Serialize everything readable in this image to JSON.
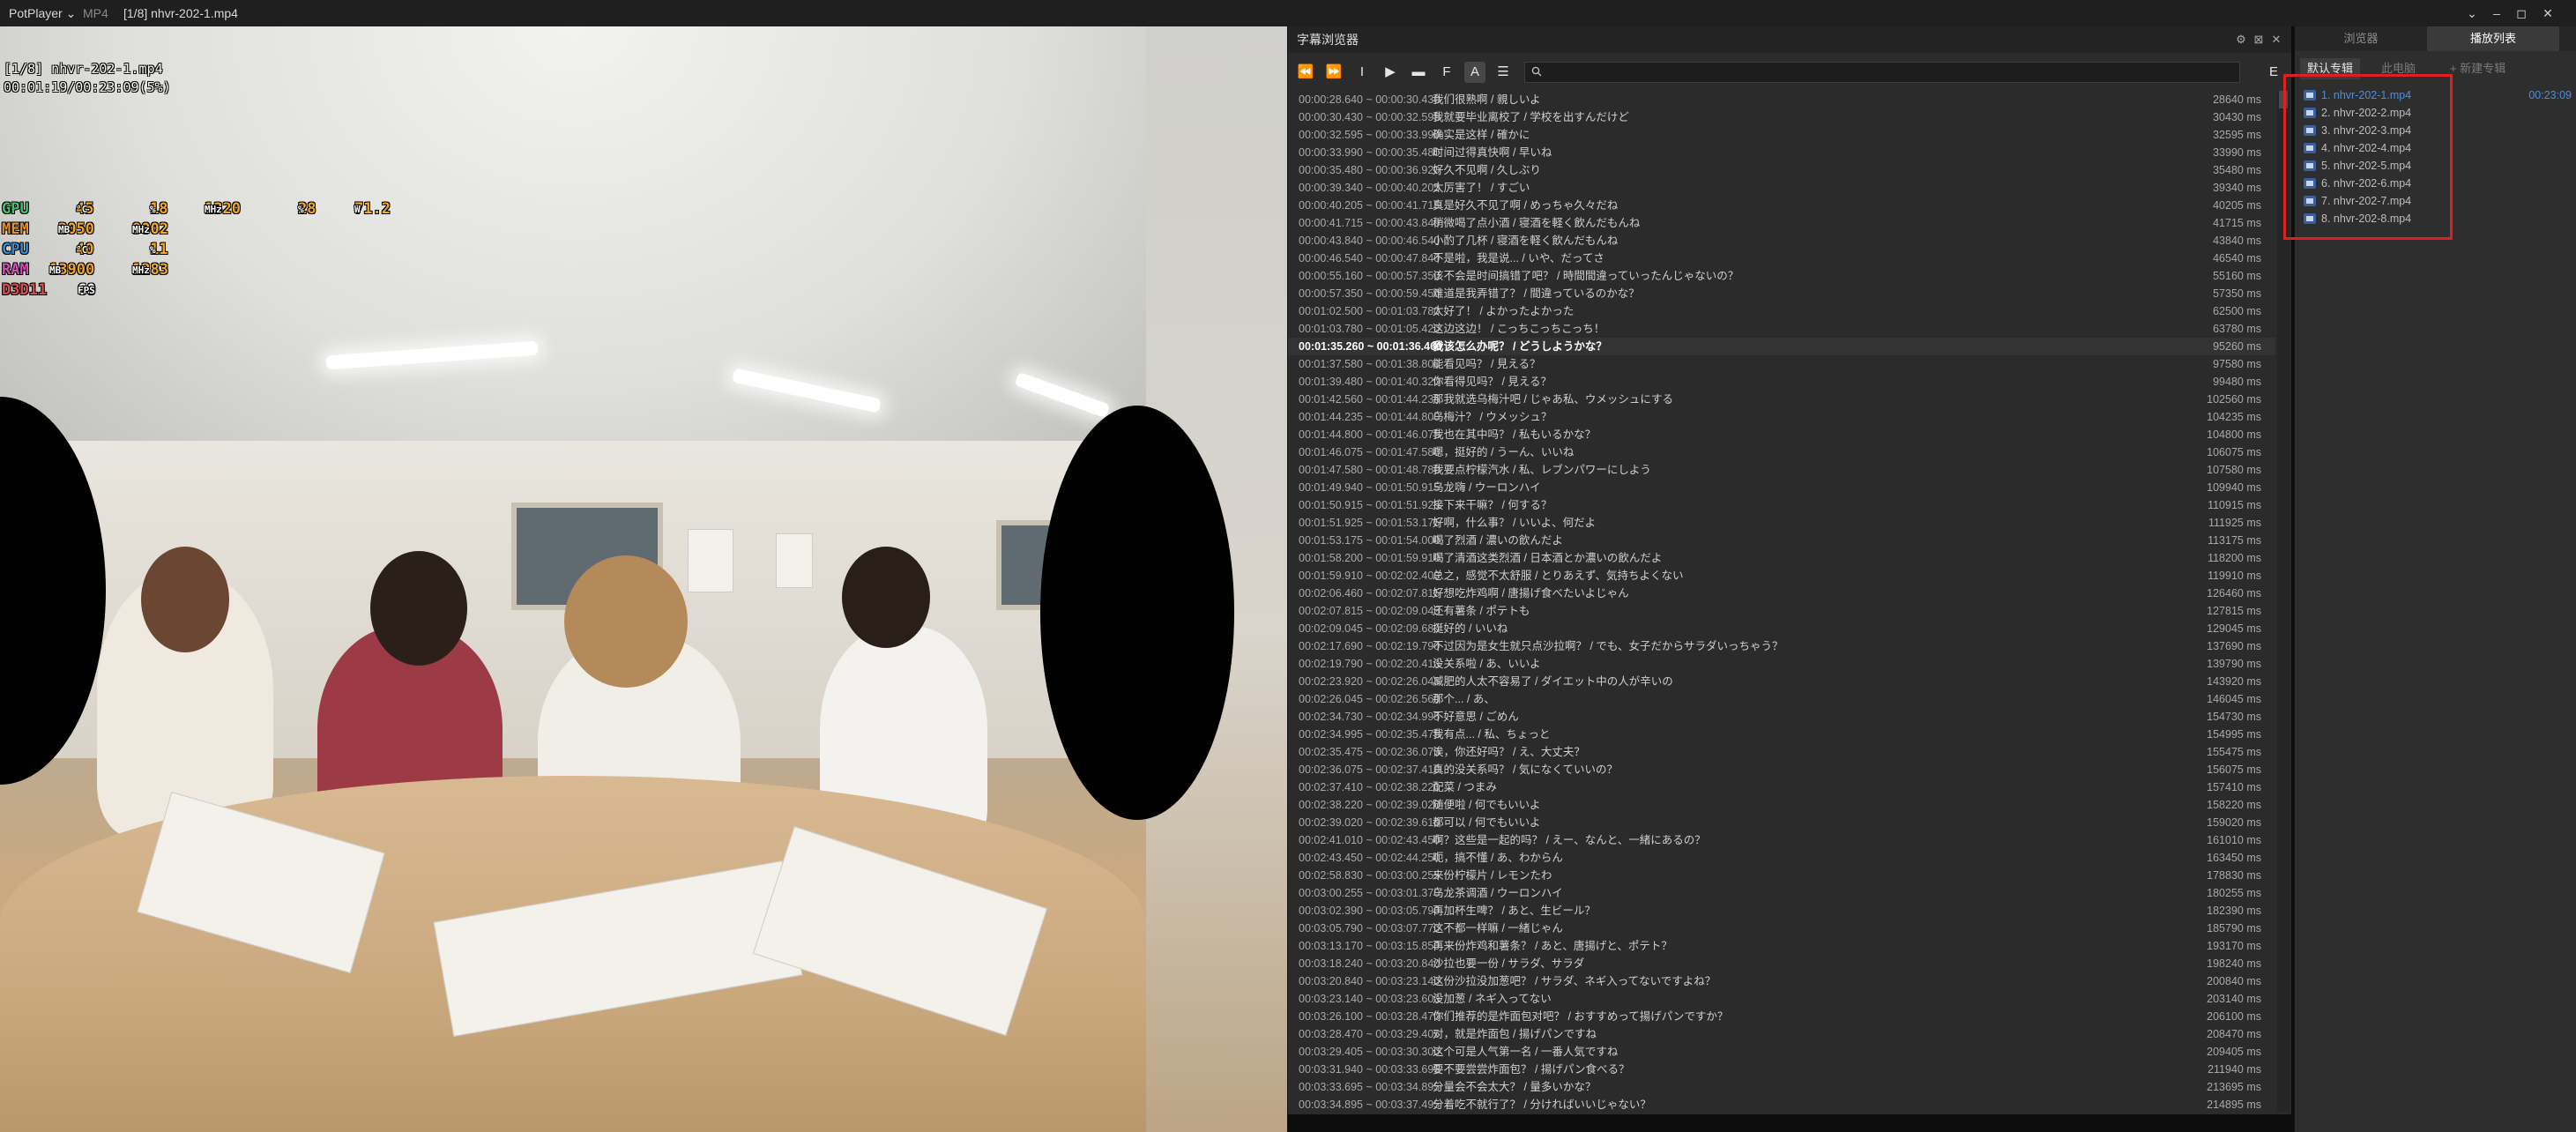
{
  "titlebar": {
    "app": "PotPlayer",
    "format": "MP4",
    "file": "[1/8] nhvr-202-1.mp4",
    "controls": [
      "⌄",
      "–",
      "◻",
      "✕"
    ]
  },
  "osd": {
    "line1": "[1/8] nhvr-202-1.mp4",
    "line2": "00:01:19/00:23:09(5%)"
  },
  "stats": [
    {
      "label": "GPU",
      "v1": "45",
      "u1": "°C",
      "v2": "18",
      "u2": "%",
      "v3": "1320",
      "u3": "MHz",
      "v4": "28",
      "u4": "%",
      "v5": "71.2",
      "u5": "W"
    },
    {
      "label": "MEM",
      "v1": "2050",
      "u1": "MB",
      "v2": "9002",
      "u2": "MHz"
    },
    {
      "label": "CPU",
      "v1": "40",
      "u1": "°C",
      "v2": "11",
      "u2": "%"
    },
    {
      "label": "RAM",
      "v1": "13900",
      "u1": "MB",
      "v2": "1283",
      "u2": "MHz"
    },
    {
      "label": "D3D11",
      "v1": "60",
      "u1": "FPS"
    }
  ],
  "subtitle_browser": {
    "title": "字幕浏览器",
    "search_placeholder": "",
    "header_buttons": [
      "⚙",
      "⊠",
      "✕"
    ],
    "toolbar": [
      "⏪",
      "⏩",
      "I",
      "▶",
      "▬",
      "F",
      "A",
      "☰"
    ],
    "right_button": "E",
    "current_index": 16,
    "rows": [
      {
        "time": "00:00:28.640 ~ 00:00:30.430",
        "text": "我们很熟啊 / 親しいよ",
        "ms": "28640 ms"
      },
      {
        "time": "00:00:30.430 ~ 00:00:32.595",
        "text": "我就要毕业离校了 / 学校を出すんだけど",
        "ms": "30430 ms"
      },
      {
        "time": "00:00:32.595 ~ 00:00:33.990",
        "text": "确实是这样 / 確かに",
        "ms": "32595 ms"
      },
      {
        "time": "00:00:33.990 ~ 00:00:35.480",
        "text": "时间过得真快啊 / 早いね",
        "ms": "33990 ms"
      },
      {
        "time": "00:00:35.480 ~ 00:00:36.920",
        "text": "好久不见啊 / 久しぶり",
        "ms": "35480 ms"
      },
      {
        "time": "00:00:39.340 ~ 00:00:40.205",
        "text": "太厉害了！ / すごい",
        "ms": "39340 ms"
      },
      {
        "time": "00:00:40.205 ~ 00:00:41.715",
        "text": "真是好久不见了啊 / めっちゃ久々だね",
        "ms": "40205 ms"
      },
      {
        "time": "00:00:41.715 ~ 00:00:43.840",
        "text": "稍微喝了点小酒 / 寝酒を軽く飲んだもんね",
        "ms": "41715 ms"
      },
      {
        "time": "00:00:43.840 ~ 00:00:46.540",
        "text": "小酌了几杯 / 寝酒を軽く飲んだもんね",
        "ms": "43840 ms"
      },
      {
        "time": "00:00:46.540 ~ 00:00:47.840",
        "text": "不是啦，我是说... / いや、だってさ",
        "ms": "46540 ms"
      },
      {
        "time": "00:00:55.160 ~ 00:00:57.350",
        "text": "该不会是时间搞错了吧？ / 時間間違っていったんじゃないの？",
        "ms": "55160 ms"
      },
      {
        "time": "00:00:57.350 ~ 00:00:59.450",
        "text": "难道是我弄错了？ / 間違っているのかな？",
        "ms": "57350 ms"
      },
      {
        "time": "00:01:02.500 ~ 00:01:03.780",
        "text": "太好了！ / よかったよかった",
        "ms": "62500 ms"
      },
      {
        "time": "00:01:03.780 ~ 00:01:05.420",
        "text": "这边这边！ / こっちこっちこっち！",
        "ms": "63780 ms"
      },
      {
        "time": "00:01:35.260 ~ 00:01:36.460",
        "text": "我该怎么办呢？ / どうしようかな？",
        "ms": "95260 ms"
      },
      {
        "time": "00:01:37.580 ~ 00:01:38.800",
        "text": "能看见吗？ / 見える？",
        "ms": "97580 ms"
      },
      {
        "time": "00:01:39.480 ~ 00:01:40.320",
        "text": "你看得见吗？ / 見える？",
        "ms": "99480 ms"
      },
      {
        "time": "00:01:42.560 ~ 00:01:44.235",
        "text": "那我就选乌梅汁吧 / じゃあ私、ウメッシュにする",
        "ms": "102560 ms"
      },
      {
        "time": "00:01:44.235 ~ 00:01:44.800",
        "text": "乌梅汁？ / ウメッシュ？",
        "ms": "104235 ms"
      },
      {
        "time": "00:01:44.800 ~ 00:01:46.075",
        "text": "我也在其中吗？ / 私もいるかな？",
        "ms": "104800 ms"
      },
      {
        "time": "00:01:46.075 ~ 00:01:47.580",
        "text": "嗯，挺好的 / うーん、いいね",
        "ms": "106075 ms"
      },
      {
        "time": "00:01:47.580 ~ 00:01:48.780",
        "text": "我要点柠檬汽水 / 私、レブンパワーにしよう",
        "ms": "107580 ms"
      },
      {
        "time": "00:01:49.940 ~ 00:01:50.915",
        "text": "乌龙嗨 / ウーロンハイ",
        "ms": "109940 ms"
      },
      {
        "time": "00:01:50.915 ~ 00:01:51.925",
        "text": "接下来干嘛？ / 何する？",
        "ms": "110915 ms"
      },
      {
        "time": "00:01:51.925 ~ 00:01:53.175",
        "text": "好啊，什么事？ / いいよ、何だよ",
        "ms": "111925 ms"
      },
      {
        "time": "00:01:53.175 ~ 00:01:54.000",
        "text": "喝了烈酒 / 濃いの飲んだよ",
        "ms": "113175 ms"
      },
      {
        "time": "00:01:58.200 ~ 00:01:59.910",
        "text": "喝了清酒这类烈酒 / 日本酒とか濃いの飲んだよ",
        "ms": "118200 ms"
      },
      {
        "time": "00:01:59.910 ~ 00:02:02.400",
        "text": "总之，感觉不太舒服 / とりあえず、気持ちよくない",
        "ms": "119910 ms"
      },
      {
        "time": "00:02:06.460 ~ 00:02:07.815",
        "text": "好想吃炸鸡啊 / 唐揚げ食べたいよじゃん",
        "ms": "126460 ms"
      },
      {
        "time": "00:02:07.815 ~ 00:02:09.045",
        "text": "还有薯条 / ポテトも",
        "ms": "127815 ms"
      },
      {
        "time": "00:02:09.045 ~ 00:02:09.680",
        "text": "挺好的 / いいね",
        "ms": "129045 ms"
      },
      {
        "time": "00:02:17.690 ~ 00:02:19.790",
        "text": "不过因为是女生就只点沙拉啊？ / でも、女子だからサラダいっちゃう？",
        "ms": "137690 ms"
      },
      {
        "time": "00:02:19.790 ~ 00:02:20.410",
        "text": "没关系啦 / あ、いいよ",
        "ms": "139790 ms"
      },
      {
        "time": "00:02:23.920 ~ 00:02:26.045",
        "text": "减肥的人太不容易了 / ダイエット中の人が辛いの",
        "ms": "143920 ms"
      },
      {
        "time": "00:02:26.045 ~ 00:02:26.560",
        "text": "那个... / あ、",
        "ms": "146045 ms"
      },
      {
        "time": "00:02:34.730 ~ 00:02:34.995",
        "text": "不好意思 / ごめん",
        "ms": "154730 ms"
      },
      {
        "time": "00:02:34.995 ~ 00:02:35.475",
        "text": "我有点... / 私、ちょっと",
        "ms": "154995 ms"
      },
      {
        "time": "00:02:35.475 ~ 00:02:36.075",
        "text": "诶，你还好吗？ / え、大丈夫？",
        "ms": "155475 ms"
      },
      {
        "time": "00:02:36.075 ~ 00:02:37.410",
        "text": "真的没关系吗？ / 気になくていいの？",
        "ms": "156075 ms"
      },
      {
        "time": "00:02:37.410 ~ 00:02:38.220",
        "text": "配菜 / つまみ",
        "ms": "157410 ms"
      },
      {
        "time": "00:02:38.220 ~ 00:02:39.020",
        "text": "随便啦 / 何でもいいよ",
        "ms": "158220 ms"
      },
      {
        "time": "00:02:39.020 ~ 00:02:39.610",
        "text": "都可以 / 何でもいいよ",
        "ms": "159020 ms"
      },
      {
        "time": "00:02:41.010 ~ 00:02:43.450",
        "text": "啊？这些是一起的吗？ / えー、なんと、一緒にあるの？",
        "ms": "161010 ms"
      },
      {
        "time": "00:02:43.450 ~ 00:02:44.250",
        "text": "呃，搞不懂 / あ、わからん",
        "ms": "163450 ms"
      },
      {
        "time": "00:02:58.830 ~ 00:03:00.255",
        "text": "来份柠檬片 / レモンたわ",
        "ms": "178830 ms"
      },
      {
        "time": "00:03:00.255 ~ 00:03:01.370",
        "text": "乌龙茶调酒 / ウーロンハイ",
        "ms": "180255 ms"
      },
      {
        "time": "00:03:02.390 ~ 00:03:05.790",
        "text": "再加杯生啤？ / あと、生ビール？",
        "ms": "182390 ms"
      },
      {
        "time": "00:03:05.790 ~ 00:03:07.770",
        "text": "这不都一样嘛 / 一緒じゃん",
        "ms": "185790 ms"
      },
      {
        "time": "00:03:13.170 ~ 00:03:15.850",
        "text": "再来份炸鸡和薯条？ / あと、唐揚げと、ポテト？",
        "ms": "193170 ms"
      },
      {
        "time": "00:03:18.240 ~ 00:03:20.840",
        "text": "沙拉也要一份 / サラダ、サラダ",
        "ms": "198240 ms"
      },
      {
        "time": "00:03:20.840 ~ 00:03:23.140",
        "text": "这份沙拉没加葱吧？ / サラダ、ネギ入ってないですよね？",
        "ms": "200840 ms"
      },
      {
        "time": "00:03:23.140 ~ 00:03:23.600",
        "text": "没加葱 / ネギ入ってない",
        "ms": "203140 ms"
      },
      {
        "time": "00:03:26.100 ~ 00:03:28.470",
        "text": "你们推荐的是炸面包对吧？ / おすすめって揚げパンですか？",
        "ms": "206100 ms"
      },
      {
        "time": "00:03:28.470 ~ 00:03:29.405",
        "text": "对，就是炸面包 / 揚げパンですね",
        "ms": "208470 ms"
      },
      {
        "time": "00:03:29.405 ~ 00:03:30.300",
        "text": "这个可是人气第一名 / 一番人気ですね",
        "ms": "209405 ms"
      },
      {
        "time": "00:03:31.940 ~ 00:03:33.695",
        "text": "要不要尝尝炸面包？ / 揚げパン食べる？",
        "ms": "211940 ms"
      },
      {
        "time": "00:03:33.695 ~ 00:03:34.895",
        "text": "分量会不会太大？ / 量多いかな？",
        "ms": "213695 ms"
      },
      {
        "time": "00:03:34.895 ~ 00:03:37.495",
        "text": "分着吃不就行了？ / 分ければいいじゃない？",
        "ms": "214895 ms"
      }
    ]
  },
  "playlist": {
    "tabs": [
      "浏览器",
      "播放列表"
    ],
    "active_tab": 1,
    "subtabs": [
      "默认专辑",
      "此电脑",
      "+ 新建专辑"
    ],
    "items": [
      {
        "name": "1. nhvr-202-1.mp4",
        "duration": "00:23:09",
        "playing": true
      },
      {
        "name": "2. nhvr-202-2.mp4",
        "duration": "",
        "playing": false
      },
      {
        "name": "3. nhvr-202-3.mp4",
        "duration": "",
        "playing": false
      },
      {
        "name": "4. nhvr-202-4.mp4",
        "duration": "",
        "playing": false
      },
      {
        "name": "5. nhvr-202-5.mp4",
        "duration": "",
        "playing": false
      },
      {
        "name": "6. nhvr-202-6.mp4",
        "duration": "",
        "playing": false
      },
      {
        "name": "7. nhvr-202-7.mp4",
        "duration": "",
        "playing": false
      },
      {
        "name": "8. nhvr-202-8.mp4",
        "duration": "",
        "playing": false
      }
    ]
  }
}
